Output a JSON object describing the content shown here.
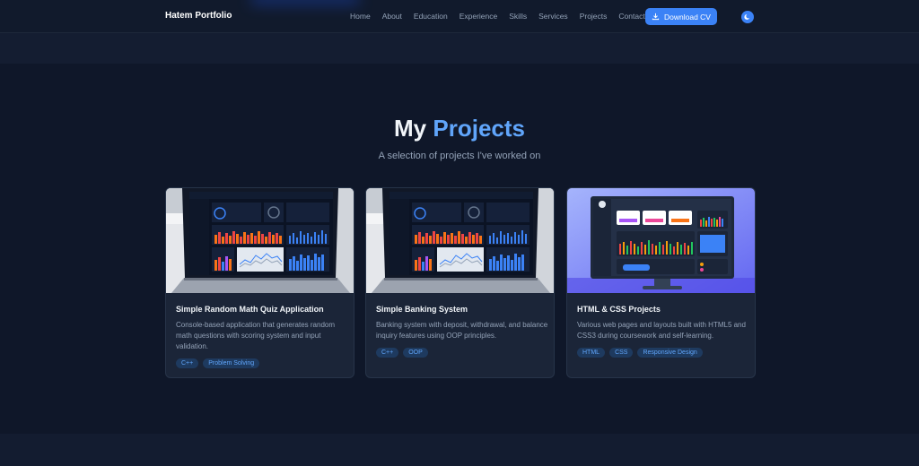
{
  "navbar": {
    "brand": "Hatem Portfolio",
    "links": [
      "Home",
      "About",
      "Education",
      "Experience",
      "Skills",
      "Services",
      "Projects",
      "Contact"
    ],
    "cv_label": "Download CV",
    "accent_color": "#3b82f6",
    "download_icon": "download-icon",
    "theme_icon": "theme-toggle-icon"
  },
  "section": {
    "title_plain": "My",
    "title_accent": "Projects",
    "subtitle": "A selection of projects I've worked on"
  },
  "projects": [
    {
      "title": "Simple Random Math Quiz Application",
      "description": "Console-based application that generates random math questions with scoring system and input validation.",
      "tags": [
        "C++",
        "Problem Solving"
      ]
    },
    {
      "title": "Simple Banking System",
      "description": "Banking system with deposit, withdrawal, and balance inquiry features using OOP principles.",
      "tags": [
        "C++",
        "OOP"
      ]
    },
    {
      "title": "HTML & CSS Projects",
      "description": "Various web pages and layouts built with HTML5 and CSS3 during coursework and self-learning.",
      "tags": [
        "HTML",
        "CSS",
        "Responsive Design"
      ]
    }
  ]
}
